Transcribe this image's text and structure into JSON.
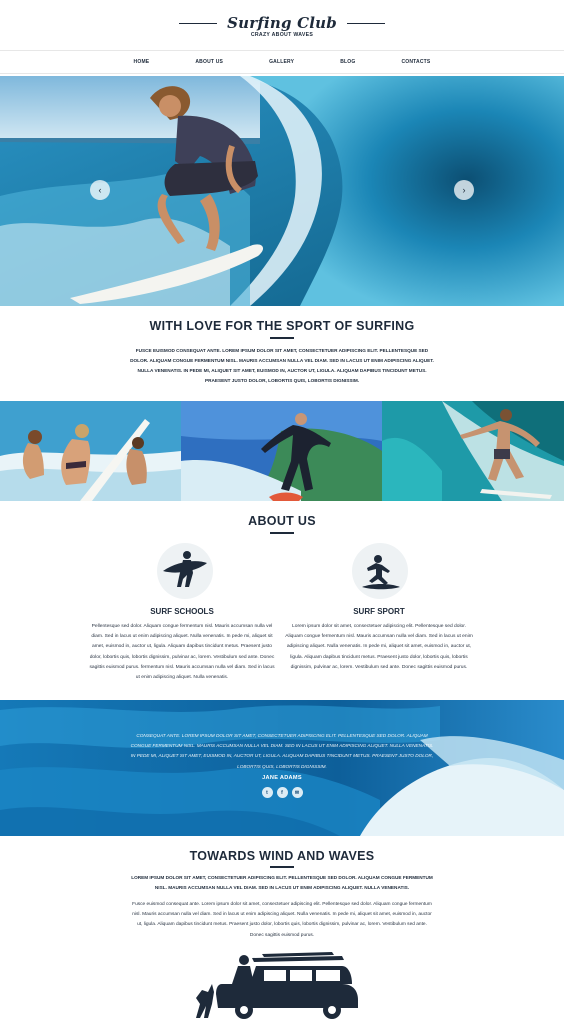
{
  "header": {
    "logo": "Surfing Club",
    "tagline": "CRAZY ABOUT WAVES"
  },
  "nav": {
    "items": [
      "HOME",
      "ABOUT US",
      "GALLERY",
      "BLOG",
      "CONTACTS"
    ]
  },
  "slider": {
    "prev_icon": "chevron-left-icon",
    "next_icon": "chevron-right-icon",
    "prev_glyph": "‹",
    "next_glyph": "›"
  },
  "intro": {
    "title": "WITH LOVE FOR THE SPORT OF SURFING",
    "text": "FUSCE EUISMOD CONSEQUAT ANTE. LOREM IPSUM DOLOR SIT AMET, CONSECTETUER ADIPISCING ELIT. PELLENTESQUE SED DOLOR. ALIQUAM CONGUE FERMENTUM NISL. MAURIS ACCUMSAN NULLA VEL DIAM. SED IN LACUS UT ENIM ADIPISCING ALIQUET. NULLA VENENATIS. IN PEDE MI, ALIQUET SIT AMET, EUISMOD IN, AUCTOR UT, LIGULA. ALIQUAM DAPIBUS TINCIDUNT METUS. PRAESENT JUSTO DOLOR, LOBORTIS QUIS, LOBORTIS DIGNISSIM."
  },
  "about": {
    "title": "ABOUT US",
    "columns": [
      {
        "title": "SURF SCHOOLS",
        "icon": "surfer-with-board-icon",
        "text": "Pellentesque sed dolor. Aliquam congue fermentum nisl. Mauris accumsan nulla vel diam. Sed in lacus ut enim adipiscing aliquet. Nulla venenatis. In pede mi, aliquet sit amet, euismod in, auctor ut, ligula. Aliquam dapibus tincidunt metus. Praesent justo dolor, lobortis quis, lobortis dignissim, pulvinar ac, lorem. Vestibulum sed ante. Donec sagittis euismod purus. fermentum nisl. Mauris accumsan nulla vel diam. Sed in lacus ut enim adipiscing aliquet. Nulla venenatis."
      },
      {
        "title": "SURF SPORT",
        "icon": "surfer-riding-icon",
        "text": "Lorem ipsum dolor sit amet, consectetuer adipiscing elit. Pellentesque sed dolor. Aliquam congue fermentum nisl. Mauris accumsan nulla vel diam. Sed in lacus ut enim adipiscing aliquet. Nulla venenatis. In pede mi, aliquet sit amet, euismod in, auctor ut, ligula. Aliquam dapibus tincidunt metus. Praesent justo dolor, lobortis quis, lobortis dignissim, pulvinar ac, lorem. Vestibulum sed ante. Donec sagittis euismod purus."
      }
    ]
  },
  "testimonial": {
    "text": "CONSEQUAT ANTE. LOREM IPSUM DOLOR SIT AMET, CONSECTETUER ADIPISCING ELIT. PELLENTESQUE SED DOLOR. ALIQUAM CONGUE FERMENTUM NISL. MAURIS ACCUMSAN NULLA VEL DIAM. SED IN LACUS UT ENIM ADIPISCING ALIQUET. NULLA VENENATIS. IN PEDE MI, ALIQUET SIT AMET, EUISMOD IN, AUCTOR UT, LIGULA. ALIQUAM DAPIBUS TINCIDUNT METUS. PRAESENT JUSTO DOLOR, LOBORTIS QUIS, LOBORTIS DIGNISSIM.",
    "author": "JANE ADAMS",
    "social": [
      {
        "icon": "twitter-icon",
        "glyph": "t"
      },
      {
        "icon": "facebook-icon",
        "glyph": "f"
      },
      {
        "icon": "email-icon",
        "glyph": "✉"
      }
    ]
  },
  "wind": {
    "title": "TOWARDS WIND AND WAVES",
    "bold_text": "LOREM IPSUM DOLOR SIT AMET, CONSECTETUER ADIPISCING ELIT. PELLENTESQUE SED DOLOR. ALIQUAM CONGUE FERMENTUM NISL. MAURIS ACCUMSAN NULLA VEL DIAM. SED IN LACUS UT ENIM ADIPISCING ALIQUET. NULLA VENENATIS.",
    "text": "Fusce euismod consequat ante. Lorem ipsum dolor sit amet, consectetuer adipiscing elit. Pellentesque sed dolor. Aliquam congue fermentum nisl. Mauris accumsan nulla vel diam. Sed in lacus ut enim adipiscing aliquet. Nulla venenatis. In pede mi, aliquet sit amet, euismod in, auctor ut, ligula. Aliquam dapibus tincidunt metus. Praesent justo dolor, lobortis quis, lobortis dignissim, pulvinar ac, lorem. Vestibulum sed ante. Donec sagittis euismod purus.",
    "illustration": "surf-car-silhouette-icon"
  },
  "colors": {
    "navy": "#1e2a3a",
    "ocean": "#1a7fb8",
    "light_circle": "#eef2f4"
  }
}
